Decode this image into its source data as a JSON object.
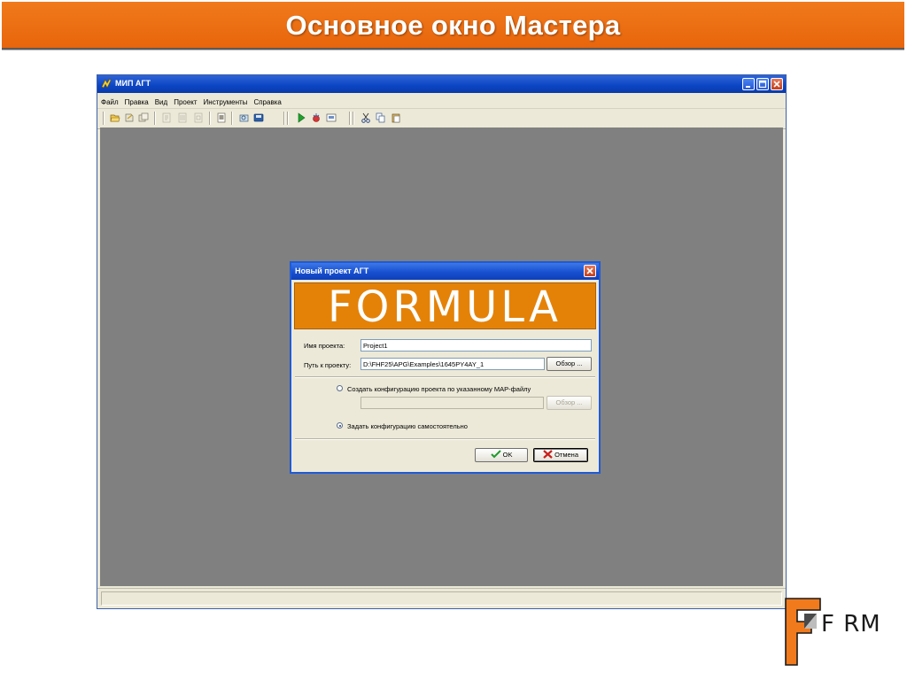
{
  "slide": {
    "title": "Основное окно Мастера",
    "colors": {
      "banner": "#e8650c",
      "banner_text": "#ffffff",
      "logo_orange": "#f07a1c"
    },
    "corner_logo": {
      "text": "F RM",
      "icon": "formula-logo-icon"
    }
  },
  "app": {
    "title": "МИП АГТ",
    "icon": "app-icon",
    "window_buttons": [
      "minimize-icon",
      "maximize-icon",
      "close-icon"
    ],
    "menu": [
      "Файл",
      "Правка",
      "Вид",
      "Проект",
      "Инструменты",
      "Справка"
    ],
    "toolbar_icons": [
      "open-icon",
      "save-icon",
      "save-all-icon",
      "disabled-icon-1",
      "disabled-icon-2",
      "disabled-icon-3",
      "document-icon",
      "print-preview-icon",
      "database-icon",
      "run-icon",
      "debug-icon",
      "properties-icon",
      "cut-icon",
      "copy-icon",
      "paste-icon"
    ],
    "workspace_color": "#808080"
  },
  "dialog": {
    "title": "Новый проект АГТ",
    "logo_text": "FORMULA",
    "project_name_label": "Имя проекта:",
    "project_name_value": "Project1",
    "project_path_label": "Путь к проекту:",
    "project_path_value": "D:\\FHF25\\APG\\Examples\\1645PY4AY_1",
    "browse_label": "Обзор ...",
    "option_map_label": "Создать конфигурацию проекта по указанному MAP-файлу",
    "map_file_value": "",
    "browse_map_label": "Обзор ...",
    "option_manual_label": "Задать конфигурацию самостоятельно",
    "selected_option": "manual",
    "ok_label": "OK",
    "cancel_label": "Отмена"
  }
}
